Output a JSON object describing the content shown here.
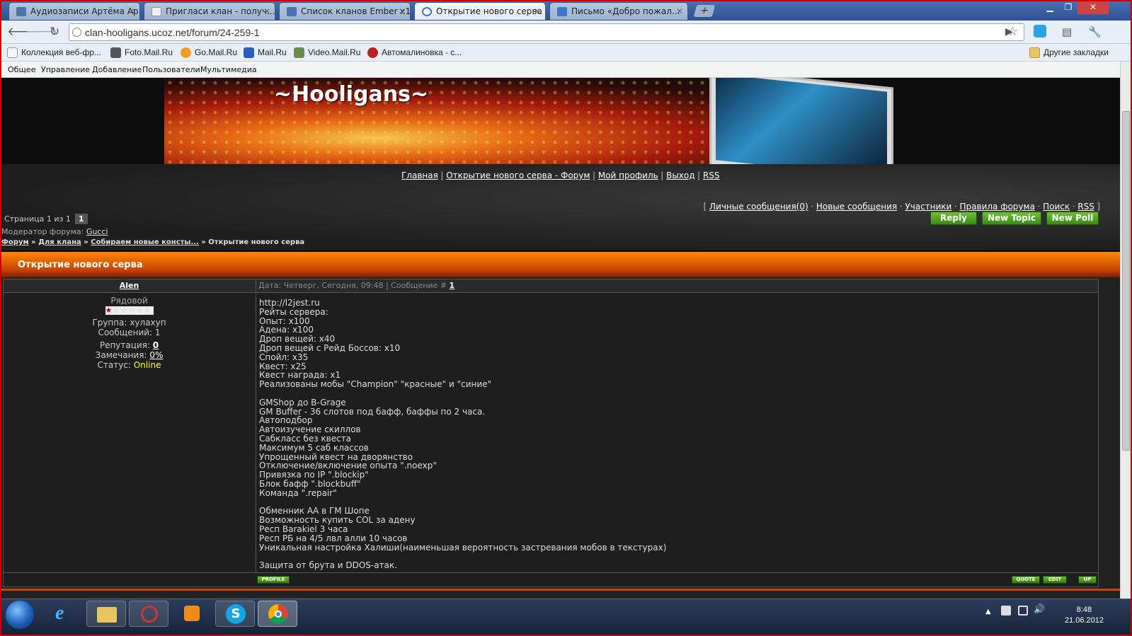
{
  "browser": {
    "tabs": [
      {
        "label": "Аудиозаписи Артёма Ар...",
        "icon": "vk-audio-icon"
      },
      {
        "label": "Пригласи клан - получ...",
        "icon": "page-icon"
      },
      {
        "label": "Список кланов Ember x1...",
        "icon": "ember-icon"
      },
      {
        "label": "Открытие нового серва ...",
        "icon": "ucoz-icon"
      },
      {
        "label": "Письмо «Добро пожал...",
        "icon": "mail-icon"
      }
    ],
    "url": "clan-hooligans.ucoz.net/forum/24-259-1",
    "bookmarks": [
      {
        "label": "Коллекция веб-фр...",
        "icon": "bookmark-icon"
      },
      {
        "label": "Foto.Mail.Ru",
        "icon": "camera-icon"
      },
      {
        "label": "Go.Mail.Ru",
        "icon": "search-icon"
      },
      {
        "label": "Mail.Ru",
        "icon": "mailru-icon"
      },
      {
        "label": "Video.Mail.Ru",
        "icon": "video-icon"
      },
      {
        "label": "Автомалиновка - с...",
        "icon": "car-icon"
      }
    ],
    "other_bookmarks": "Другие закладки"
  },
  "ucoz_menu": [
    "Общее",
    "Управление",
    "Добавление",
    "Пользователи",
    "Мультимедиа"
  ],
  "site": {
    "title": "~Hooligans~",
    "main_links": [
      "Главная",
      "Открытие нового серва - Форум",
      "Мой профиль",
      "Выход",
      "RSS"
    ],
    "forum_links": [
      "Личные сообщения(0)",
      "Новые сообщения",
      "Участники",
      "Правила форума",
      "Поиск",
      "RSS"
    ]
  },
  "forum": {
    "pager_label": "Страница 1 из 1",
    "pager_current": "1",
    "moderator_label": "Модератор форума:",
    "moderator": "Gucci",
    "breadcrumbs": [
      "Форум",
      "Для клана",
      "Собираем новые консты..."
    ],
    "breadcrumb_current": "Открытие нового серва",
    "buttons": {
      "reply": "Reply",
      "new_topic": "New Topic",
      "new_poll": "New Poll"
    },
    "thread_title": "Открытие нового серва"
  },
  "post": {
    "author": "Alen",
    "meta_prefix": "Дата: Четверг, Сегодня, 09:48 | Сообщение #",
    "meta_number": "1",
    "rank": "Рядовой",
    "group": "Группа: хулахуп",
    "messages": "Сообщений: 1",
    "reputation_label": "Репутация:",
    "reputation": "0",
    "warnings_label": "Замечания:",
    "warnings": "0%",
    "status_label": "Статус:",
    "status": "Online",
    "status_color": "#ffff00",
    "body_lines": [
      "http://l2jest.ru",
      "Рейты сервера:",
      "Опыт: x100",
      "Адена: x100",
      "Дроп вещей: x40",
      "Дроп вещей с Рейд Боссов: x10",
      "Спойл: x35",
      "Квест: x25",
      "Квест награда: x1",
      "Реализованы мобы \"Champion\" \"красные\" и \"синие\"",
      "",
      "GMShop до B-Grage",
      "GM Buffer - 36 слотов под бафф, баффы по 2 часа.",
      "Автоподбор",
      "Автоизучение скиллов",
      "Сабкласс без квеста",
      "Максимум 5 саб классов",
      "Упрощенный квест на дворянство",
      "Отключение/включение опыта \".noexp\"",
      "Привязка по IP \".blockip\"",
      "Блок бафф \".blockbuff\"",
      "Команда \".repair\"",
      "",
      "Обменник АА в ГМ Шопе",
      "Возможность купить COL за адену",
      "Респ Barakiel 3 часа",
      "Респ РБ на 4/5 лвл алли 10 часов",
      "Уникальная настройка Халиши(наименьшая вероятность застревания мобов в текстурах)",
      "",
      "Защита от брута и DDOS-атак."
    ],
    "footer_buttons": {
      "profile": "PROFILE",
      "quote": "QUOTE",
      "edit": "EDIT",
      "up": "UP"
    }
  },
  "taskbar": {
    "time": "8:48",
    "date": "21.06.2012",
    "apps": [
      "start-orb-icon",
      "ie-icon",
      "explorer-icon",
      "snipping-icon",
      "media-player-icon",
      "skype-icon",
      "chrome-icon"
    ]
  },
  "colors": {
    "accent_orange": "#e06000",
    "button_green": "#3b8a16",
    "browser_blue": "#2d4f94"
  }
}
